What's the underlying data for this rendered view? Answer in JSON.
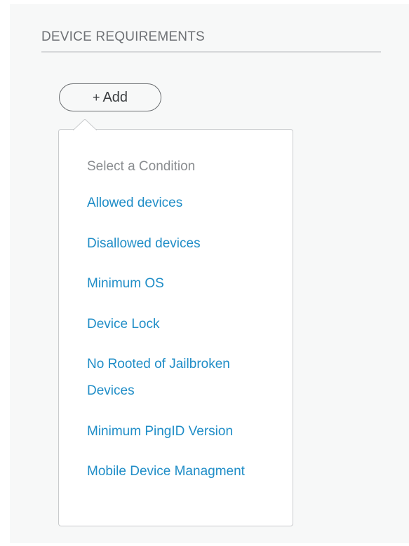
{
  "section": {
    "title": "DEVICE REQUIREMENTS"
  },
  "add_button": {
    "plus": "+",
    "label": "Add"
  },
  "dropdown": {
    "header": "Select a Condition",
    "options": [
      "Allowed devices",
      "Disallowed devices",
      "Minimum OS",
      "Device Lock",
      "No Rooted of Jailbroken Devices",
      "Minimum PingID Version",
      "Mobile Device Managment"
    ]
  },
  "colors": {
    "link": "#1f8dc7",
    "title": "#6e7175",
    "panel_bg": "#f7f8f8",
    "border": "#c9cbcd"
  }
}
